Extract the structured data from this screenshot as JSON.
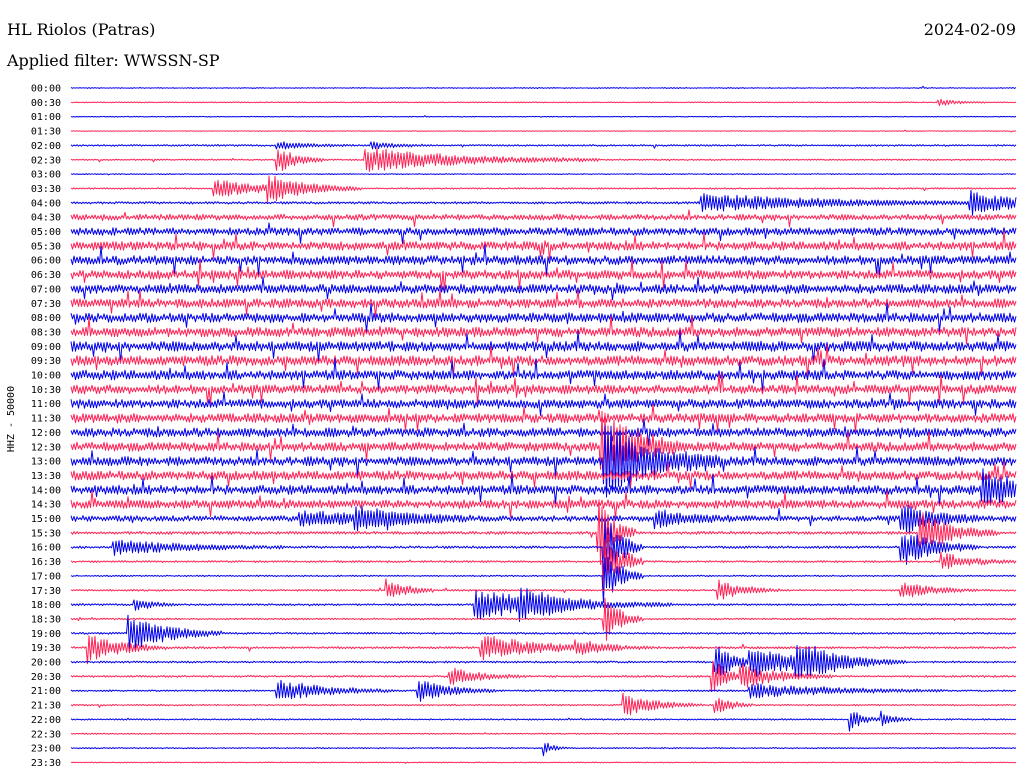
{
  "header": {
    "title": "HL Riolos (Patras)",
    "date": "2024-02-09",
    "filter_text": "Applied filter: WWSSN-SP"
  },
  "colors": {
    "blue": "#0000ee",
    "red": "#ff2255"
  },
  "chart_data": {
    "type": "line",
    "title": "HL Riolos (Patras)",
    "ylabel": "HHZ - 50000",
    "xlabel": "",
    "x_range_minutes": [
      0,
      30
    ],
    "y_tick_labels": [
      "00:00",
      "00:30",
      "01:00",
      "01:30",
      "02:00",
      "02:30",
      "03:00",
      "03:30",
      "04:00",
      "04:30",
      "05:00",
      "05:30",
      "06:00",
      "06:30",
      "07:00",
      "07:30",
      "08:00",
      "08:30",
      "09:00",
      "09:30",
      "10:00",
      "10:30",
      "11:00",
      "11:30",
      "12:00",
      "12:30",
      "13:00",
      "13:30",
      "14:00",
      "14:30",
      "15:00",
      "15:30",
      "16:00",
      "16:30",
      "17:00",
      "17:30",
      "18:00",
      "18:30",
      "19:00",
      "19:30",
      "20:00",
      "20:30",
      "21:00",
      "21:30",
      "22:00",
      "22:30",
      "23:00",
      "23:30"
    ],
    "line_colors": [
      "blue",
      "red"
    ],
    "noise_level": [
      0.2,
      0.2,
      0.15,
      0.15,
      0.35,
      0.3,
      0.2,
      0.3,
      0.5,
      1.2,
      1.6,
      1.8,
      1.9,
      1.9,
      1.9,
      1.9,
      2.0,
      2.0,
      2.1,
      2.1,
      2.0,
      1.9,
      1.9,
      1.9,
      1.9,
      1.9,
      1.9,
      1.9,
      1.9,
      1.8,
      1.2,
      0.6,
      0.5,
      0.4,
      0.3,
      0.35,
      0.4,
      0.35,
      0.4,
      0.45,
      0.4,
      0.4,
      0.35,
      0.3,
      0.3,
      0.25,
      0.25,
      0.2
    ],
    "events": [
      {
        "row": 1,
        "minute": 27.5,
        "amplitude": 3,
        "duration": 0.6
      },
      {
        "row": 4,
        "minute": 6.5,
        "amplitude": 3,
        "duration": 1.0
      },
      {
        "row": 4,
        "minute": 9.5,
        "amplitude": 3,
        "duration": 0.8
      },
      {
        "row": 5,
        "minute": 6.5,
        "amplitude": 12,
        "duration": 0.6
      },
      {
        "row": 5,
        "minute": 9.3,
        "amplitude": 10,
        "duration": 3.0
      },
      {
        "row": 7,
        "minute": 4.5,
        "amplitude": 7,
        "duration": 1.8
      },
      {
        "row": 7,
        "minute": 6.2,
        "amplitude": 9,
        "duration": 1.2
      },
      {
        "row": 8,
        "minute": 20.0,
        "amplitude": 7,
        "duration": 4.0
      },
      {
        "row": 8,
        "minute": 28.5,
        "amplitude": 9,
        "duration": 1.5
      },
      {
        "row": 25,
        "minute": 16.8,
        "amplitude": 30,
        "duration": 1.0
      },
      {
        "row": 26,
        "minute": 16.9,
        "amplitude": 30,
        "duration": 1.5
      },
      {
        "row": 28,
        "minute": 28.9,
        "amplitude": 14,
        "duration": 1.2
      },
      {
        "row": 30,
        "minute": 7.2,
        "amplitude": 6,
        "duration": 2.0
      },
      {
        "row": 30,
        "minute": 9.0,
        "amplitude": 8,
        "duration": 1.5
      },
      {
        "row": 30,
        "minute": 18.5,
        "amplitude": 8,
        "duration": 1.0
      },
      {
        "row": 30,
        "minute": 26.3,
        "amplitude": 12,
        "duration": 1.0
      },
      {
        "row": 31,
        "minute": 16.7,
        "amplitude": 30,
        "duration": 0.5
      },
      {
        "row": 31,
        "minute": 26.9,
        "amplitude": 18,
        "duration": 1.0
      },
      {
        "row": 32,
        "minute": 1.3,
        "amplitude": 6,
        "duration": 2.2
      },
      {
        "row": 32,
        "minute": 26.3,
        "amplitude": 16,
        "duration": 1.0
      },
      {
        "row": 32,
        "minute": 16.9,
        "amplitude": 30,
        "duration": 0.5
      },
      {
        "row": 33,
        "minute": 16.9,
        "amplitude": 30,
        "duration": 0.5
      },
      {
        "row": 33,
        "minute": 27.6,
        "amplitude": 7,
        "duration": 1.0
      },
      {
        "row": 34,
        "minute": 16.9,
        "amplitude": 25,
        "duration": 0.5
      },
      {
        "row": 35,
        "minute": 10.0,
        "amplitude": 10,
        "duration": 0.6
      },
      {
        "row": 35,
        "minute": 20.5,
        "amplitude": 9,
        "duration": 0.8
      },
      {
        "row": 35,
        "minute": 26.3,
        "amplitude": 7,
        "duration": 1.0
      },
      {
        "row": 36,
        "minute": 12.8,
        "amplitude": 12,
        "duration": 2.5
      },
      {
        "row": 36,
        "minute": 14.2,
        "amplitude": 10,
        "duration": 1.0
      },
      {
        "row": 36,
        "minute": 2.0,
        "amplitude": 6,
        "duration": 0.5
      },
      {
        "row": 37,
        "minute": 16.9,
        "amplitude": 20,
        "duration": 0.5
      },
      {
        "row": 38,
        "minute": 1.8,
        "amplitude": 16,
        "duration": 1.2
      },
      {
        "row": 39,
        "minute": 0.5,
        "amplitude": 12,
        "duration": 1.0
      },
      {
        "row": 39,
        "minute": 13.0,
        "amplitude": 10,
        "duration": 1.8
      },
      {
        "row": 39,
        "minute": 16.0,
        "amplitude": 5,
        "duration": 1.0
      },
      {
        "row": 40,
        "minute": 20.4,
        "amplitude": 16,
        "duration": 0.6
      },
      {
        "row": 40,
        "minute": 21.5,
        "amplitude": 12,
        "duration": 2.0
      },
      {
        "row": 40,
        "minute": 23.0,
        "amplitude": 14,
        "duration": 1.0
      },
      {
        "row": 41,
        "minute": 12.0,
        "amplitude": 7,
        "duration": 1.0
      },
      {
        "row": 41,
        "minute": 20.3,
        "amplitude": 16,
        "duration": 0.5
      },
      {
        "row": 41,
        "minute": 21.2,
        "amplitude": 10,
        "duration": 1.2
      },
      {
        "row": 42,
        "minute": 6.5,
        "amplitude": 9,
        "duration": 1.5
      },
      {
        "row": 42,
        "minute": 11.0,
        "amplitude": 9,
        "duration": 1.0
      },
      {
        "row": 42,
        "minute": 21.5,
        "amplitude": 6,
        "duration": 2.5
      },
      {
        "row": 43,
        "minute": 17.5,
        "amplitude": 10,
        "duration": 1.0
      },
      {
        "row": 43,
        "minute": 20.4,
        "amplitude": 9,
        "duration": 0.5
      },
      {
        "row": 44,
        "minute": 24.7,
        "amplitude": 10,
        "duration": 0.4
      },
      {
        "row": 44,
        "minute": 25.7,
        "amplitude": 7,
        "duration": 0.4
      },
      {
        "row": 46,
        "minute": 15.0,
        "amplitude": 6,
        "duration": 0.3
      }
    ]
  }
}
